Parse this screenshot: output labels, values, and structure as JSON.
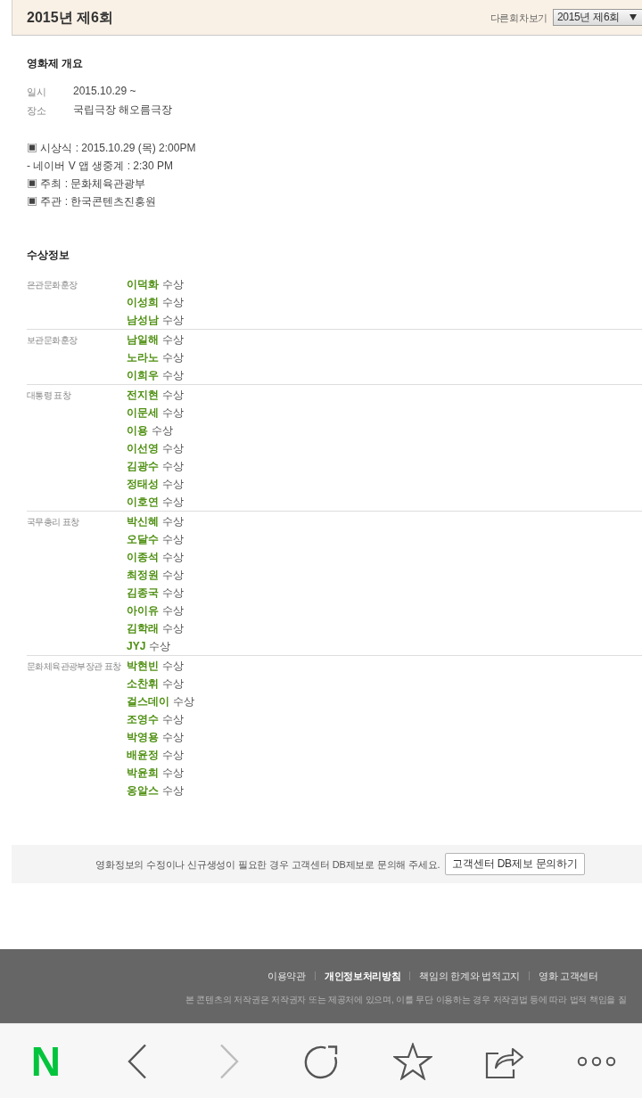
{
  "header": {
    "title": "2015년 제6회",
    "picker_label": "다른회차보기",
    "picker_value": "2015년 제6회"
  },
  "overview": {
    "heading": "영화제 개요",
    "facts": [
      {
        "label": "일시",
        "value": "2015.10.29 ~"
      },
      {
        "label": "장소",
        "value": "국립극장 해오름극장"
      }
    ],
    "notes": [
      "▣ 시상식 : 2015.10.29 (목) 2:00PM",
      "- 네이버 V 앱 생중계 : 2:30 PM",
      "▣ 주최 : 문화체육관광부",
      "▣ 주관 : 한국콘텐츠진흥원"
    ]
  },
  "awards": {
    "heading": "수상정보",
    "groups": [
      {
        "category": "은관문화훈장",
        "winners": [
          {
            "name": "이덕화",
            "label": "수상"
          },
          {
            "name": "이성희",
            "label": "수상"
          },
          {
            "name": "남성남",
            "label": "수상"
          }
        ]
      },
      {
        "category": "보관문화훈장",
        "winners": [
          {
            "name": "남일해",
            "label": "수상"
          },
          {
            "name": "노라노",
            "label": "수상"
          },
          {
            "name": "이희우",
            "label": "수상"
          }
        ]
      },
      {
        "category": "대통령 표창",
        "winners": [
          {
            "name": "전지현",
            "label": "수상"
          },
          {
            "name": "이문세",
            "label": "수상"
          },
          {
            "name": "이용",
            "label": "수상"
          },
          {
            "name": "이선영",
            "label": "수상"
          },
          {
            "name": "김광수",
            "label": "수상"
          },
          {
            "name": "정태성",
            "label": "수상"
          },
          {
            "name": "이호연",
            "label": "수상"
          }
        ]
      },
      {
        "category": "국무총리 표창",
        "winners": [
          {
            "name": "박신혜",
            "label": "수상"
          },
          {
            "name": "오달수",
            "label": "수상"
          },
          {
            "name": "이종석",
            "label": "수상"
          },
          {
            "name": "최정원",
            "label": "수상"
          },
          {
            "name": "김종국",
            "label": "수상"
          },
          {
            "name": "아이유",
            "label": "수상"
          },
          {
            "name": "김학래",
            "label": "수상"
          },
          {
            "name": "JYJ",
            "label": "수상"
          }
        ]
      },
      {
        "category": "문화체육관광부장관 표창",
        "winners": [
          {
            "name": "박현빈",
            "label": "수상"
          },
          {
            "name": "소찬휘",
            "label": "수상"
          },
          {
            "name": "걸스데이",
            "label": "수상"
          },
          {
            "name": "조영수",
            "label": "수상"
          },
          {
            "name": "박영용",
            "label": "수상"
          },
          {
            "name": "배윤정",
            "label": "수상"
          },
          {
            "name": "박윤희",
            "label": "수상"
          },
          {
            "name": "옹알스",
            "label": "수상"
          }
        ]
      }
    ]
  },
  "notice": {
    "text": "영화정보의 수정이나 신규생성이 필요한 경우 고객센터 DB제보로 문의해 주세요.",
    "button": "고객센터 DB제보 문의하기"
  },
  "footer": {
    "links": [
      {
        "label": "이용약관",
        "highlighted": false
      },
      {
        "label": "개인정보처리방침",
        "highlighted": true
      },
      {
        "label": "책임의 한계와 법적고지",
        "highlighted": false
      },
      {
        "label": "영화 고객센터",
        "highlighted": false
      }
    ],
    "copyright": "본 콘텐츠의 저작권은 저작권자 또는 제공처에 있으며, 이를 무단 이용하는 경우 저작권법 등에 따라 법적 책임을 질"
  },
  "toolbar": [
    {
      "kind": "logo",
      "label": "N",
      "disabled": false
    },
    {
      "kind": "back",
      "disabled": false
    },
    {
      "kind": "forward",
      "disabled": true
    },
    {
      "kind": "refresh",
      "disabled": false
    },
    {
      "kind": "bookmark",
      "disabled": false
    },
    {
      "kind": "share",
      "disabled": false
    },
    {
      "kind": "more",
      "disabled": false
    }
  ]
}
